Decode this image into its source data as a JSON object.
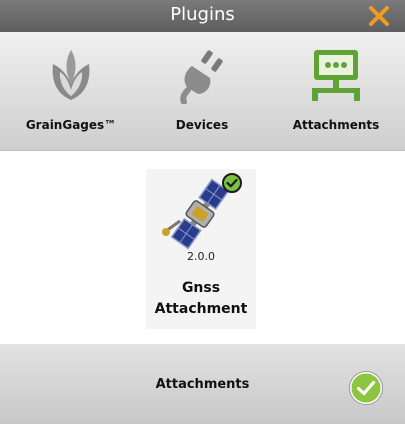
{
  "window": {
    "title": "Plugins",
    "close_icon": "close-icon"
  },
  "tabs": [
    {
      "label": "GrainGages™",
      "icon": "leaf-icon",
      "selected": false
    },
    {
      "label": "Devices",
      "icon": "plug-icon",
      "selected": false
    },
    {
      "label": "Attachments",
      "icon": "network-icon",
      "selected": true,
      "color": "#5fa235"
    }
  ],
  "plugins": [
    {
      "version": "2.0.0",
      "name_line1": "Gnss",
      "name_line2": "Attachment",
      "installed": true,
      "icon": "satellite-icon"
    }
  ],
  "footer": {
    "title": "Attachments",
    "confirm_icon": "check-circle-icon"
  },
  "colors": {
    "titlebar": "#6b6b6b",
    "close": "#f29a25",
    "accent_green": "#5fa235",
    "check_green": "#8cc63f"
  }
}
